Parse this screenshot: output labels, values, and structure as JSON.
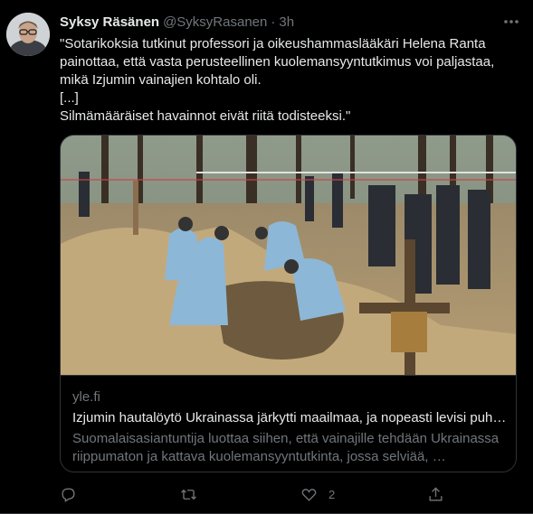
{
  "tweet": {
    "name": "Syksy Räsänen",
    "handle": "@SyksyRasanen",
    "time": "3h",
    "text_lines": [
      "\"Sotarikoksia tutkinut professori ja oikeushammaslääkäri Helena Ranta",
      "painottaa, että vasta perusteellinen kuolemansyyntutkimus voi paljastaa,",
      "mikä Izjumin vainajien kohtalo oli.",
      "[...]",
      "Silmämääräiset havainnot eivät riitä todisteeksi.\""
    ]
  },
  "card": {
    "domain": "yle.fi",
    "title": "Izjumin hautalöytö Ukrainassa järkytti maailmaa, ja nopeasti levisi puh…",
    "description_lines": [
      "Suomalaisasiantuntija luottaa siihen, että vainajille tehdään Ukrainassa",
      "riippumaton ja kattava kuolemansyyntutkinta, jossa selviää, …"
    ]
  },
  "actions": {
    "reply_icon": "reply-icon",
    "retweet_icon": "retweet-icon",
    "like_icon": "like-icon",
    "like_count": "2",
    "share_icon": "share-icon"
  },
  "colors": {
    "background": "#000000",
    "text": "#e7e9ea",
    "secondary": "#71767b",
    "border": "#2f3336"
  }
}
